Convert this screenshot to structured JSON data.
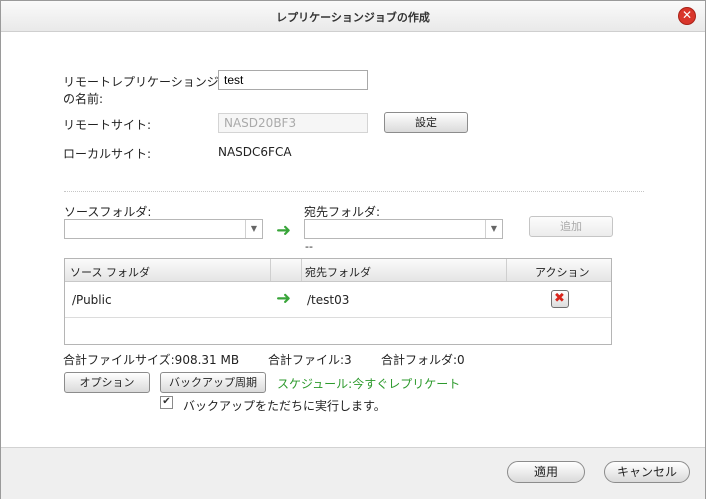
{
  "dialog": {
    "title": "レプリケーションジョブの作成",
    "close_glyph": "✕",
    "job_name_label_line1": "リモートレプリケーションジョブ",
    "job_name_label_line2": "の名前:",
    "job_name_value": "test",
    "remote_site_label": "リモートサイト:",
    "remote_site_value": "NASD20BF3",
    "settings_button": "設定",
    "local_site_label": "ローカルサイト:",
    "local_site_value": "NASDC6FCA",
    "source_folder_label": "ソースフォルダ:",
    "dest_folder_label": "宛先フォルダ:",
    "dest_placeholder": "--",
    "add_button": "追加",
    "table": {
      "headers": [
        "ソース フォルダ",
        "宛先フォルダ",
        "アクション"
      ],
      "rows": [
        {
          "source": "/Public",
          "dest": "/test03"
        }
      ]
    },
    "total_size": "合計ファイルサイズ:908.31 MB",
    "total_files": "合計ファイル:3",
    "total_folders": "合計フォルダ:0",
    "options_button": "オプション",
    "backup_schedule_button": "バックアップ周期",
    "schedule_text": "スケジュール:今すぐレプリケート",
    "run_now_checked": true,
    "run_now_label": "バックアップをただちに実行します。",
    "apply_button": "適用",
    "cancel_button": "キャンセル"
  },
  "icons": {
    "close": "close-icon",
    "arrow": "arrow-right-icon",
    "delete": "delete-icon",
    "dropdown": "chevron-down-icon"
  },
  "colors": {
    "accent_green": "#39a53a",
    "close_red": "#d9362b"
  }
}
